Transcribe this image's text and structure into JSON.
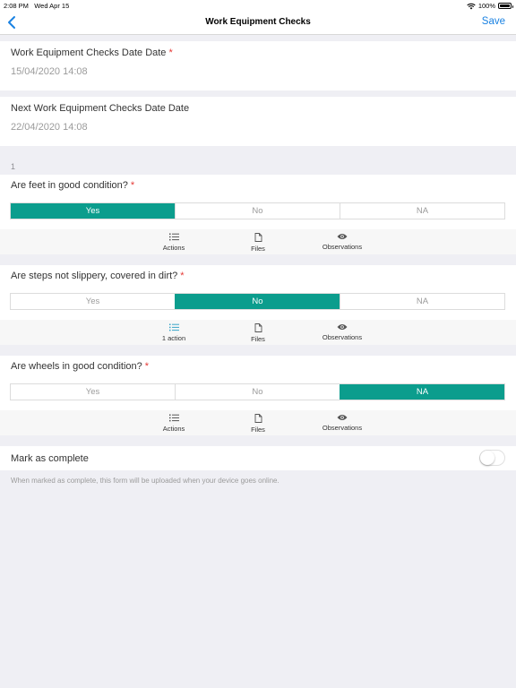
{
  "statusbar": {
    "time": "2:08 PM",
    "date": "Wed Apr 15",
    "battery": "100%",
    "wifi_icon": "wifi-icon",
    "battery_icon": "battery-icon"
  },
  "navbar": {
    "title": "Work Equipment Checks",
    "save_label": "Save",
    "back_icon": "chevron-left-icon"
  },
  "fields": {
    "date": {
      "label": "Work Equipment Checks Date Date",
      "required": "*",
      "value": "15/04/2020 14:08"
    },
    "next_date": {
      "label": "Next Work Equipment Checks Date Date",
      "value": "22/04/2020 14:08"
    }
  },
  "section": {
    "number": "1"
  },
  "options": {
    "yes": "Yes",
    "no": "No",
    "na": "NA"
  },
  "questions": [
    {
      "label": "Are feet in good condition?",
      "required": "*",
      "selected": "Yes",
      "actions_label": "Actions",
      "files_label": "Files",
      "observations_label": "Observations"
    },
    {
      "label": "Are steps not slippery, covered in dirt?",
      "required": "*",
      "selected": "No",
      "actions_label": "1 action",
      "files_label": "Files",
      "observations_label": "Observations"
    },
    {
      "label": "Are wheels in good condition?",
      "required": "*",
      "selected": "NA",
      "actions_label": "Actions",
      "files_label": "Files",
      "observations_label": "Observations"
    }
  ],
  "complete": {
    "label": "Mark as complete",
    "enabled": false,
    "note": "When marked as complete, this form will be uploaded when your device goes online."
  },
  "colors": {
    "accent": "#0b9d8d",
    "link": "#1a82e2",
    "required": "#e53935",
    "action_highlight": "#3aa6c9"
  },
  "icons": {
    "actions": "list-icon",
    "files": "file-icon",
    "observations": "eye-icon"
  }
}
